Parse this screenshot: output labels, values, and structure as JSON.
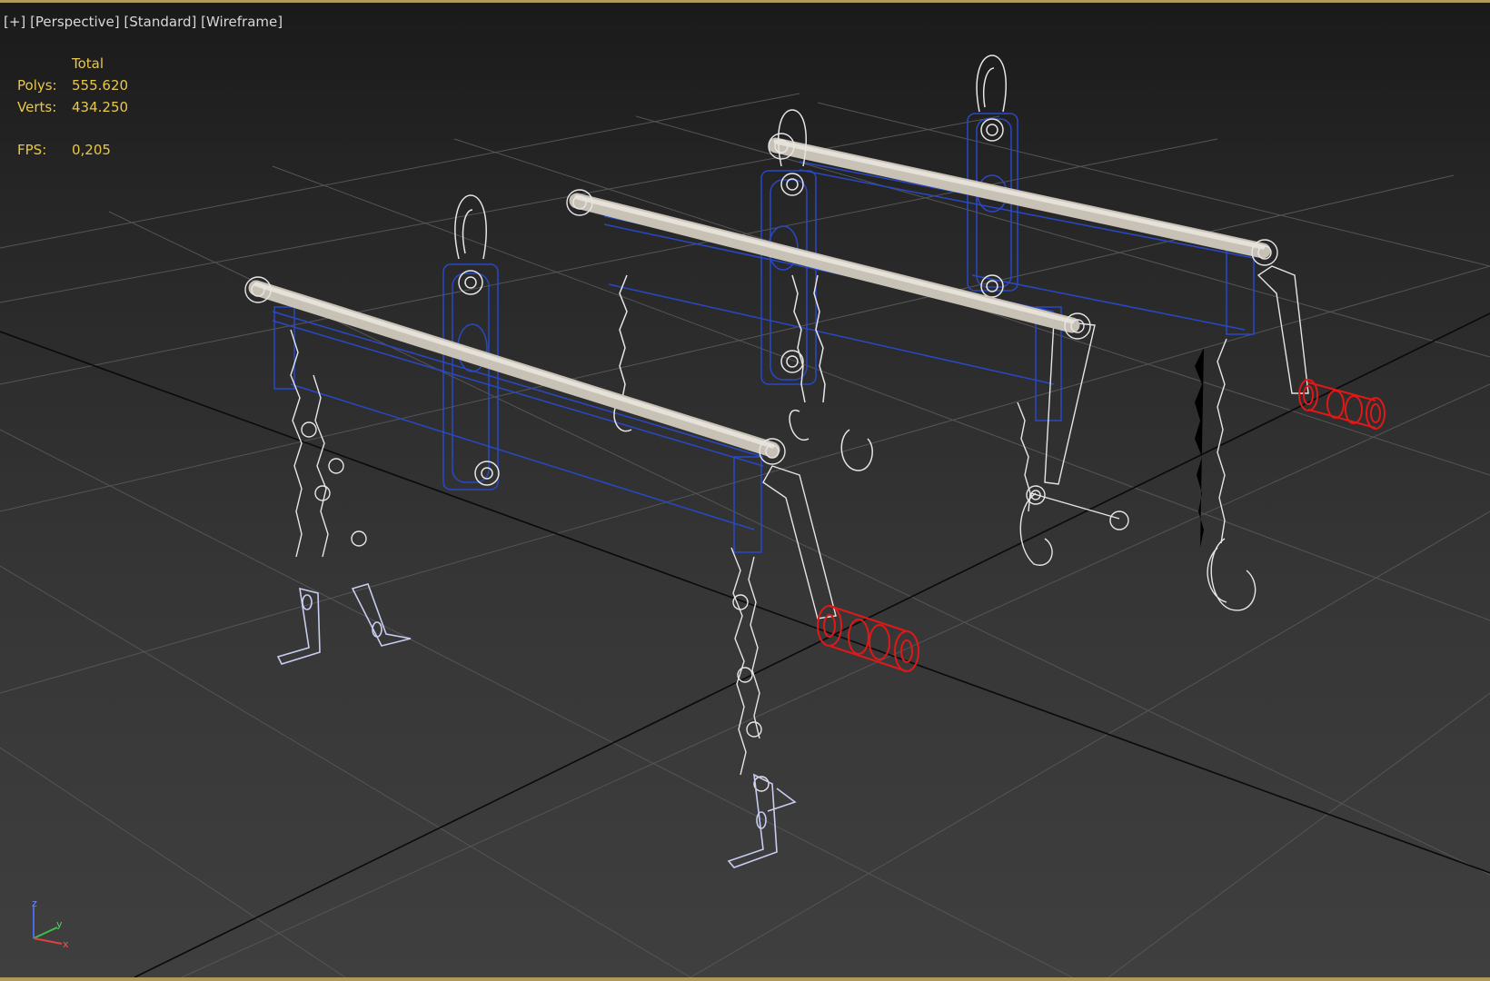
{
  "viewport": {
    "label_parts": [
      "[+]",
      "[Perspective]",
      "[Standard]",
      "[Wireframe]"
    ]
  },
  "stats": {
    "header": "Total",
    "polys_label": "Polys:",
    "polys_value": "555.620",
    "verts_label": "Verts:",
    "verts_value": "434.250",
    "fps_label": "FPS:",
    "fps_value": "0,205"
  },
  "axis_tripod": {
    "z_label": "z",
    "y_label": "y",
    "x_label": "x"
  },
  "colors": {
    "frame_border": "#b09a5a",
    "stats_text": "#e8c84a",
    "wire_white": "#e6e6e6",
    "wire_blue": "#2848c8",
    "wire_red": "#e01818",
    "grid": "#555555",
    "grid_main": "#0a0a0a"
  }
}
